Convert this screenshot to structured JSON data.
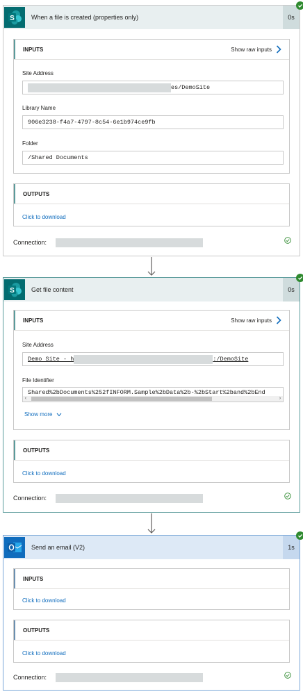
{
  "colors": {
    "link": "#0f6cbd",
    "success": "#2f8a2f",
    "teal_header": "#e8eff0",
    "blue_header": "#dde9f6"
  },
  "card1": {
    "icon": "sharepoint-icon",
    "title": "When a file is created (properties only)",
    "duration": "0s",
    "inputs": {
      "label": "INPUTS",
      "raw_label": "Show raw inputs",
      "site_address_label": "Site Address",
      "site_address_value": "es/DemoSite",
      "library_name_label": "Library Name",
      "library_name_value": "906e3238-f4a7-4797-8c54-6e1b974ce9fb",
      "folder_label": "Folder",
      "folder_value": "/Shared Documents"
    },
    "outputs": {
      "label": "OUTPUTS",
      "link": "Click to download"
    },
    "connection_label": "Connection:"
  },
  "card2": {
    "icon": "sharepoint-icon",
    "title": "Get file content",
    "duration": "0s",
    "inputs": {
      "label": "INPUTS",
      "raw_label": "Show raw inputs",
      "site_address_label": "Site Address",
      "site_address_prefix": "Demo Site - h",
      "site_address_suffix": ":/DemoSite",
      "file_identifier_label": "File Identifier",
      "file_identifier_value": "Shared%2bDocuments%252fINFORM.Sample%2bData%2b-%2bStart%2band%2bEnd",
      "show_more": "Show more"
    },
    "outputs": {
      "label": "OUTPUTS",
      "link": "Click to download"
    },
    "connection_label": "Connection:"
  },
  "card3": {
    "icon": "outlook-icon",
    "title": "Send an email (V2)",
    "duration": "1s",
    "inputs": {
      "label": "INPUTS",
      "link": "Click to download"
    },
    "outputs": {
      "label": "OUTPUTS",
      "link": "Click to download"
    },
    "connection_label": "Connection:"
  }
}
